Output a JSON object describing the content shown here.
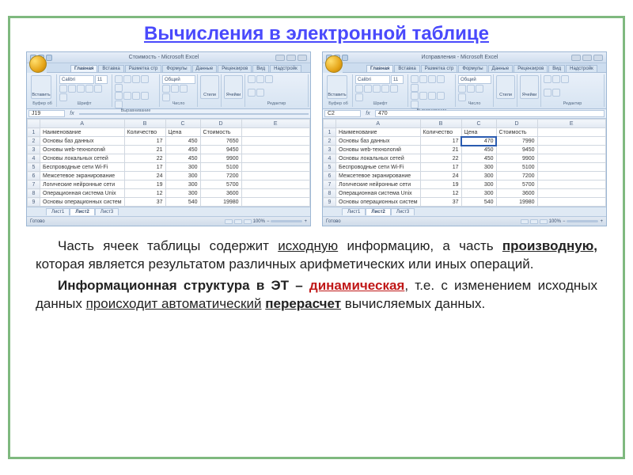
{
  "title": "Вычисления в электронной таблице",
  "body": {
    "p1a": "Часть ячеек таблицы содержит ",
    "p1b": "исходную",
    "p1c": " информацию, а часть ",
    "p1d": "производную,",
    "p1e": " которая является результатом различных арифметических или иных операций.",
    "p2a": "Информационная структура в ЭТ – ",
    "p2b": "динамическая",
    "p2c": ", т.е. с изменением исходных данных ",
    "p2d": "происходит автоматический",
    "p2e": " ",
    "p2f": "перерасчет",
    "p2g": " вычисляемых данных."
  },
  "window_titles": {
    "left": "Стоимость - Microsoft Excel",
    "right": "Исправления - Microsoft Excel"
  },
  "tabs": [
    "Главная",
    "Вставка",
    "Разметка стр",
    "Формулы",
    "Данные",
    "Рецензиров",
    "Вид",
    "Надстройк"
  ],
  "ribbon_groups": [
    "Буфер об",
    "Шрифт",
    "Выравнивание",
    "Число",
    "Редактир"
  ],
  "ribbon_labels": {
    "paste": "Вставить",
    "font": "Calibri",
    "size": "11",
    "numfmt": "Общий",
    "styles": "Стили",
    "cells": "Ячейки"
  },
  "columns": [
    "",
    "A",
    "B",
    "C",
    "D",
    "E"
  ],
  "headers": {
    "a": "Наименование",
    "b": "Количество",
    "c": "Цена",
    "d": "Стоимость"
  },
  "rows": [
    {
      "name": "Основы баз данных",
      "qty": "17"
    },
    {
      "name": "Основы web-технологий",
      "qty": "21"
    },
    {
      "name": "Основы локальных сетей",
      "qty": "22"
    },
    {
      "name": "Беспроводные сети Wi-Fi",
      "qty": "17"
    },
    {
      "name": "Межсетевое экранирование",
      "qty": "24"
    },
    {
      "name": "Логические нейронные сети",
      "qty": "19"
    },
    {
      "name": "Операционная система Unix",
      "qty": "12"
    },
    {
      "name": "Основы операционных систем",
      "qty": "37"
    }
  ],
  "left": {
    "namebox": "J19",
    "fx": "",
    "price": [
      "450",
      "450",
      "450",
      "300",
      "300",
      "300",
      "300",
      "540"
    ],
    "cost": [
      "7650",
      "9450",
      "9900",
      "5100",
      "7200",
      "5700",
      "3600",
      "19980"
    ]
  },
  "right": {
    "namebox": "C2",
    "fx": "470",
    "price": [
      "470",
      "450",
      "450",
      "300",
      "300",
      "300",
      "300",
      "540"
    ],
    "cost": [
      "7990",
      "9450",
      "9900",
      "5100",
      "7200",
      "5700",
      "3600",
      "19980"
    ]
  },
  "sheet_tabs": [
    "Лист1",
    "Лист2",
    "Лист3"
  ],
  "status": {
    "ready": "Готово",
    "zoom": "100%"
  }
}
